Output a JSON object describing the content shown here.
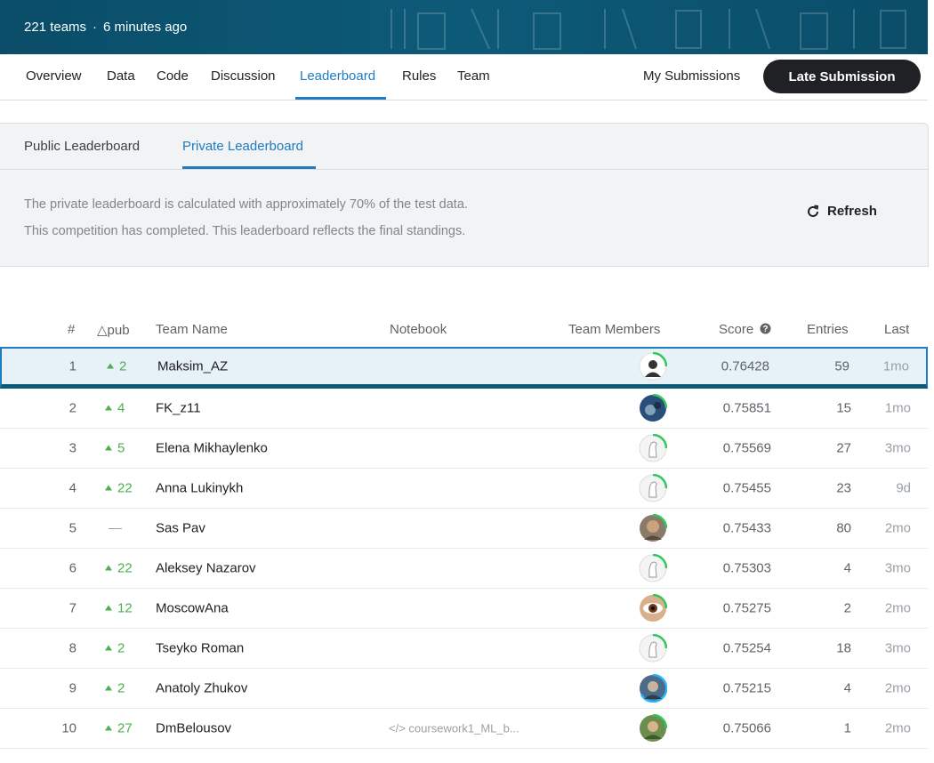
{
  "banner": {
    "teams": "221 teams",
    "updated": "6 minutes ago"
  },
  "nav": {
    "tabs": [
      "Overview",
      "Data",
      "Code",
      "Discussion",
      "Leaderboard",
      "Rules",
      "Team"
    ],
    "active": "Leaderboard",
    "my_submissions": "My Submissions",
    "late_submission": "Late Submission"
  },
  "leaderboard": {
    "subtabs": [
      "Public Leaderboard",
      "Private Leaderboard"
    ],
    "active_subtab": "Private Leaderboard",
    "info_line1": "The private leaderboard is calculated with approximately 70% of the test data.",
    "info_line2": "This competition has completed. This leaderboard reflects the final standings.",
    "refresh": "Refresh"
  },
  "table": {
    "headers": {
      "rank": "#",
      "delta": "△pub",
      "team": "Team Name",
      "notebook": "Notebook",
      "members": "Team Members",
      "score": "Score",
      "entries": "Entries",
      "last": "Last"
    },
    "rows": [
      {
        "rank": "1",
        "delta": "2",
        "name": "Maksim_AZ",
        "notebook": "",
        "score": "0.76428",
        "entries": "59",
        "last": "1mo"
      },
      {
        "rank": "2",
        "delta": "4",
        "name": "FK_z11",
        "notebook": "",
        "score": "0.75851",
        "entries": "15",
        "last": "1mo"
      },
      {
        "rank": "3",
        "delta": "5",
        "name": "Elena Mikhaylenko",
        "notebook": "",
        "score": "0.75569",
        "entries": "27",
        "last": "3mo"
      },
      {
        "rank": "4",
        "delta": "22",
        "name": "Anna Lukinykh",
        "notebook": "",
        "score": "0.75455",
        "entries": "23",
        "last": "9d"
      },
      {
        "rank": "5",
        "delta": "—",
        "name": "Sas Pav",
        "notebook": "",
        "score": "0.75433",
        "entries": "80",
        "last": "2mo"
      },
      {
        "rank": "6",
        "delta": "22",
        "name": "Aleksey Nazarov",
        "notebook": "",
        "score": "0.75303",
        "entries": "4",
        "last": "3mo"
      },
      {
        "rank": "7",
        "delta": "12",
        "name": "MoscowAna",
        "notebook": "",
        "score": "0.75275",
        "entries": "2",
        "last": "2mo"
      },
      {
        "rank": "8",
        "delta": "2",
        "name": "Tseyko Roman",
        "notebook": "",
        "score": "0.75254",
        "entries": "18",
        "last": "3mo"
      },
      {
        "rank": "9",
        "delta": "2",
        "name": "Anatoly Zhukov",
        "notebook": "",
        "score": "0.75215",
        "entries": "4",
        "last": "2mo"
      },
      {
        "rank": "10",
        "delta": "27",
        "name": "DmBelousov",
        "notebook": "coursework1_ML_b...",
        "score": "0.75066",
        "entries": "1",
        "last": "2mo"
      }
    ]
  },
  "colors": {
    "accent": "#1f7cc1",
    "banner": "#0a4d68",
    "up": "#4caf50"
  }
}
